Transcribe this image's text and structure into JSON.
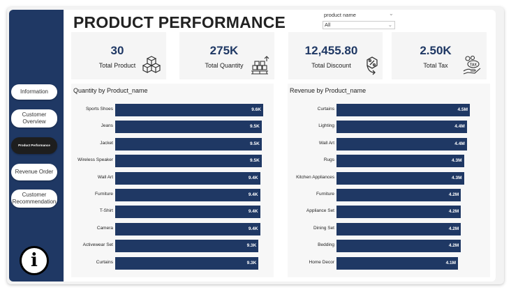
{
  "page_title": "PRODUCT PERFORMANCE",
  "slicer": {
    "label": "product name",
    "value": "All"
  },
  "nav": [
    {
      "label": "Information"
    },
    {
      "label": "Customer Overview"
    },
    {
      "label": "Product Performance"
    },
    {
      "label": "Revenue Order"
    },
    {
      "label": "Customer Recommendation"
    }
  ],
  "kpis": [
    {
      "value": "30",
      "label": "Total Product",
      "icon": "boxes-icon"
    },
    {
      "value": "275K",
      "label": "Total Quantity",
      "icon": "pallet-icon"
    },
    {
      "value": "12,455.80",
      "label": "Total Discount",
      "icon": "discount-icon"
    },
    {
      "value": "2.50K",
      "label": "Total Tax",
      "icon": "tax-icon"
    }
  ],
  "colors": {
    "accent": "#1f3864",
    "bar": "#1f3864"
  },
  "chart_data": [
    {
      "type": "bar",
      "orientation": "horizontal",
      "title": "Quantity by Product_name",
      "categories": [
        "Sports Shoes",
        "Jeans",
        "Jacket",
        "Wireless Speaker",
        "Wall Art",
        "Furniture",
        "T-Shirt",
        "Camera",
        "Activewear Set",
        "Curtains"
      ],
      "values": [
        9600,
        9500,
        9500,
        9500,
        9400,
        9400,
        9400,
        9400,
        9300,
        9300
      ],
      "labels": [
        "9.6K",
        "9.5K",
        "9.5K",
        "9.5K",
        "9.4K",
        "9.4K",
        "9.4K",
        "9.4K",
        "9.3K",
        "9.3K"
      ]
    },
    {
      "type": "bar",
      "orientation": "horizontal",
      "title": "Revenue by Product_name",
      "categories": [
        "Curtains",
        "Lighting",
        "Wall Art",
        "Rugs",
        "Kitchen Appliances",
        "Furniture",
        "Appliance Set",
        "Dining Set",
        "Bedding",
        "Home Decor"
      ],
      "values": [
        4500000,
        4400000,
        4400000,
        4300000,
        4300000,
        4200000,
        4200000,
        4200000,
        4200000,
        4100000
      ],
      "labels": [
        "4.5M",
        "4.4M",
        "4.4M",
        "4.3M",
        "4.3M",
        "4.2M",
        "4.2M",
        "4.2M",
        "4.2M",
        "4.1M"
      ]
    }
  ]
}
